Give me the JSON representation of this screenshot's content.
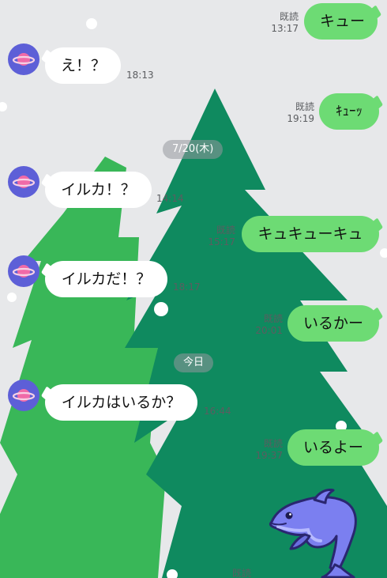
{
  "colors": {
    "background": "#e7e8ea",
    "tree_light": "#39b758",
    "tree_dark": "#0f8a5f",
    "bubble_sent": "#6ddb74",
    "bubble_received": "#ffffff",
    "avatar_bg": "#5d5fd7",
    "sticker": "#7b7ff0"
  },
  "icons": {
    "avatar": "saturn-planet-icon",
    "sticker": "dolphin-sticker"
  },
  "messages": [
    {
      "side": "right",
      "text": "キュー",
      "read": "既読",
      "time": "13:17"
    },
    {
      "side": "left",
      "text": "え！？",
      "time": "18:13"
    },
    {
      "side": "right",
      "text": "ｷｭｰｯ",
      "read": "既読",
      "time": "19:19"
    },
    {
      "divider": "7/20(木)"
    },
    {
      "side": "left",
      "text": "イルカ！？",
      "time": "14:14"
    },
    {
      "side": "right",
      "text": "キュキューキュ",
      "read": "既読",
      "time": "15:17"
    },
    {
      "side": "left",
      "text": "イルカだ！？",
      "time": "18:17"
    },
    {
      "side": "right",
      "text": "いるかー",
      "read": "既読",
      "time": "20:01"
    },
    {
      "divider": "今日"
    },
    {
      "side": "left",
      "text": "イルカはいるか？",
      "time": "16:44"
    },
    {
      "side": "right",
      "text": "いるよー",
      "read": "既読",
      "time": "19:37"
    },
    {
      "side": "right",
      "read": "既読"
    }
  ]
}
